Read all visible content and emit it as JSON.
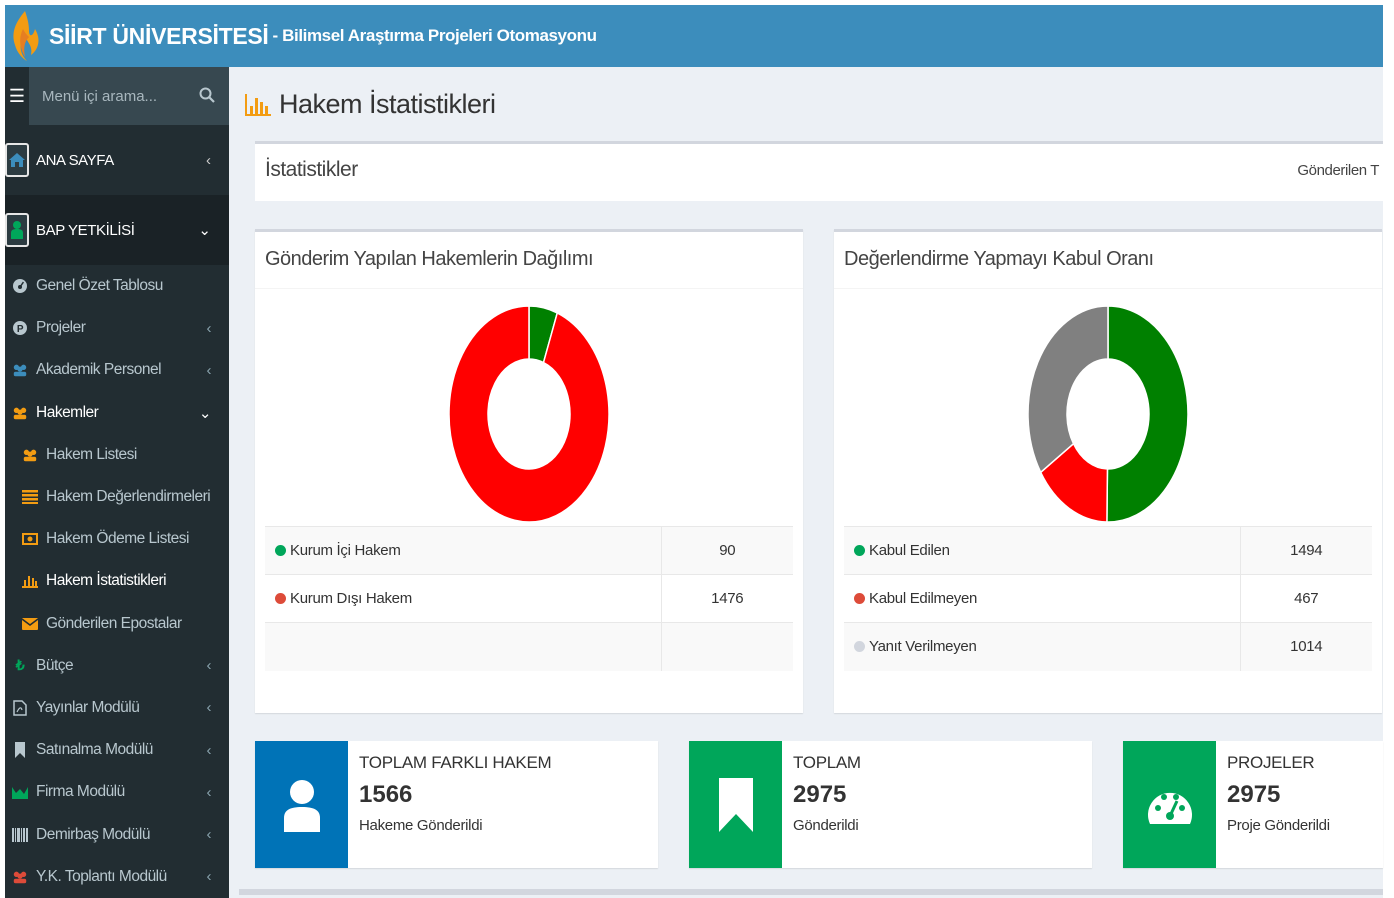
{
  "header": {
    "brand": "SİİRT ÜNİVERSİTESİ",
    "subtitle": "- Bilimsel Araştırma Projeleri Otomasyonu"
  },
  "sidebar": {
    "search_placeholder": "Menü içi arama...",
    "top_items": [
      {
        "label": "ANA SAYFA",
        "icon": "home-icon"
      },
      {
        "label": "BAP YETKİLİSİ",
        "icon": "user-icon"
      }
    ],
    "items": [
      {
        "label": "Genel Özet Tablosu",
        "icon": "dashboard-icon"
      },
      {
        "label": "Projeler",
        "icon": "p-circle-icon"
      },
      {
        "label": "Akademik Personel",
        "icon": "users-icon"
      },
      {
        "label": "Hakemler",
        "icon": "users-icon"
      },
      {
        "label": "Hakem Listesi",
        "icon": "users-icon"
      },
      {
        "label": "Hakem Değerlendirmeleri",
        "icon": "list-icon"
      },
      {
        "label": "Hakem Ödeme Listesi",
        "icon": "money-icon"
      },
      {
        "label": "Hakem İstatistikleri",
        "icon": "bar-chart-icon"
      },
      {
        "label": "Gönderilen Epostalar",
        "icon": "envelope-icon"
      },
      {
        "label": "Bütçe",
        "icon": "lira-icon"
      },
      {
        "label": "Yayınlar Modülü",
        "icon": "pdf-file-icon"
      },
      {
        "label": "Satınalma Modülü",
        "icon": "bookmark-icon"
      },
      {
        "label": "Firma Modülü",
        "icon": "area-chart-icon"
      },
      {
        "label": "Demirbaş Modülü",
        "icon": "barcode-icon"
      },
      {
        "label": "Y.K. Toplantı Modülü",
        "icon": "users-icon"
      }
    ]
  },
  "page": {
    "title": "Hakem İstatistikleri",
    "stats_title": "İstatistikler",
    "stats_right": "Gönderilen T"
  },
  "colors": {
    "header": "#3c8dbc",
    "sidebar": "#222d32",
    "green": "#008000",
    "red": "#ff0000",
    "gray": "#808080",
    "aqua_blue": "#0073b7",
    "info_green": "#00a65a"
  },
  "panel_left": {
    "title": "Gönderim Yapılan Hakemlerin Dağılımı",
    "rows": [
      {
        "label": "Kurum İçi Hakem",
        "value": "90",
        "color": "#00a65a"
      },
      {
        "label": "Kurum Dışı Hakem",
        "value": "1476",
        "color": "#dd4b39"
      }
    ]
  },
  "panel_right": {
    "title": "Değerlendirme Yapmayı Kabul Oranı",
    "rows": [
      {
        "label": "Kabul Edilen",
        "value": "1494",
        "color": "#00a65a"
      },
      {
        "label": "Kabul Edilmeyen",
        "value": "467",
        "color": "#dd4b39"
      },
      {
        "label": "Yanıt Verilmeyen",
        "value": "1014",
        "color": "#d2d6de"
      }
    ]
  },
  "info_boxes": [
    {
      "title": "TOPLAM FARKLI HAKEM",
      "number": "1566",
      "sub": "Hakeme Gönderildi",
      "icon": "user-icon"
    },
    {
      "title": "TOPLAM",
      "number": "2975",
      "sub": "Gönderildi",
      "icon": "bookmark-icon"
    },
    {
      "title": "PROJELER",
      "number": "2975",
      "sub": "Proje Gönderildi",
      "icon": "dashboard-gauge-icon"
    }
  ],
  "chart_data": [
    {
      "type": "pie",
      "title": "Gönderim Yapılan Hakemlerin Dağılımı",
      "categories": [
        "Kurum İçi Hakem",
        "Kurum Dışı Hakem"
      ],
      "values": [
        90,
        1476
      ],
      "colors": [
        "#008000",
        "#ff0000"
      ]
    },
    {
      "type": "pie",
      "title": "Değerlendirme Yapmayı Kabul Oranı",
      "categories": [
        "Kabul Edilen",
        "Kabul Edilmeyen",
        "Yanıt Verilmeyen"
      ],
      "values": [
        1494,
        467,
        1014
      ],
      "colors": [
        "#008000",
        "#ff0000",
        "#808080"
      ]
    }
  ]
}
